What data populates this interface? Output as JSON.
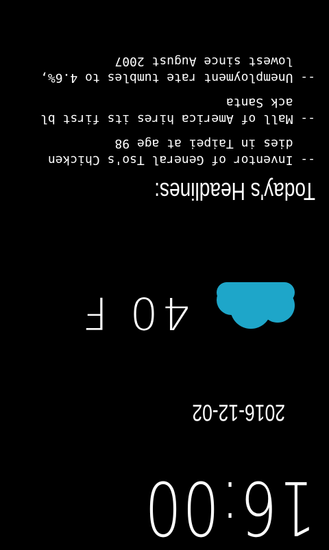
{
  "clock": {
    "time": "16:00"
  },
  "date": {
    "value": "2016-12-02"
  },
  "weather": {
    "icon": "cloud-icon",
    "icon_color": "#1ea6c9",
    "temperature": "40 F"
  },
  "headlines": {
    "title": "Today's Headlines:",
    "items": [
      {
        "line1": "-- Inventor of General Tso's Chicken",
        "line2": "   dies in Taipei at age 98"
      },
      {
        "line1": "-- Mall of America hires its first bl",
        "line2": "   ack Santa"
      },
      {
        "line1": "-- Unemployment rate tumbles to 4.6%,",
        "line2": "   lowest since August 2007"
      }
    ]
  },
  "colors": {
    "background": "#000000",
    "text": "#ffffff",
    "accent": "#1ea6c9"
  }
}
